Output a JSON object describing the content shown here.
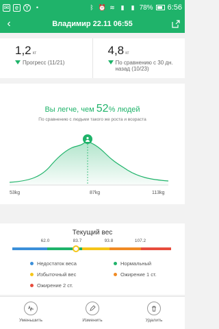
{
  "status_bar": {
    "battery": "78%",
    "time": "6:56"
  },
  "header": {
    "title": "Владимир 22.11 06:55",
    "back_icon": "back-arrow-icon",
    "share_icon": "share-icon"
  },
  "stats": [
    {
      "value": "1,2",
      "unit": "кг",
      "caption": "Прогресс (11/21)"
    },
    {
      "value": "4,8",
      "unit": "кг",
      "caption": "По сравнению с 30 дн. назад (10/23)"
    }
  ],
  "comparison": {
    "headline_prefix": "Вы легче, чем",
    "percent": "52",
    "headline_suffix": "% людей",
    "subtitle": "По сравнению с людьми такого же роста и возраста",
    "x_labels": [
      "53kg",
      "87kg",
      "113kg"
    ],
    "highlight_color": "#1fb36a"
  },
  "weight_scale": {
    "title": "Текущий вес",
    "thresholds": [
      "62.0",
      "83.7",
      "93.8",
      "107.2"
    ],
    "current_level_fraction": 0.4,
    "segments": [
      {
        "color": "#3b8fd9",
        "fraction": 0.22
      },
      {
        "color": "#1fb36a",
        "fraction": 0.22
      },
      {
        "color": "#f5c518",
        "fraction": 0.17
      },
      {
        "color": "#f08a24",
        "fraction": 0.2
      },
      {
        "color": "#e74c3c",
        "fraction": 0.19
      }
    ],
    "legend": [
      {
        "label": "Недостаток веса",
        "color": "#3b8fd9"
      },
      {
        "label": "Нормальный",
        "color": "#1fb36a"
      },
      {
        "label": "Избыточный вес",
        "color": "#f5c518"
      },
      {
        "label": "Ожирение 1 ст.",
        "color": "#f08a24"
      },
      {
        "label": "Ожирение 2 ст.",
        "color": "#e74c3c"
      }
    ]
  },
  "actions": [
    {
      "label": "Уменьшить",
      "icon": "waveform-icon"
    },
    {
      "label": "Изменить",
      "icon": "edit-icon"
    },
    {
      "label": "Удалить",
      "icon": "trash-icon"
    }
  ]
}
